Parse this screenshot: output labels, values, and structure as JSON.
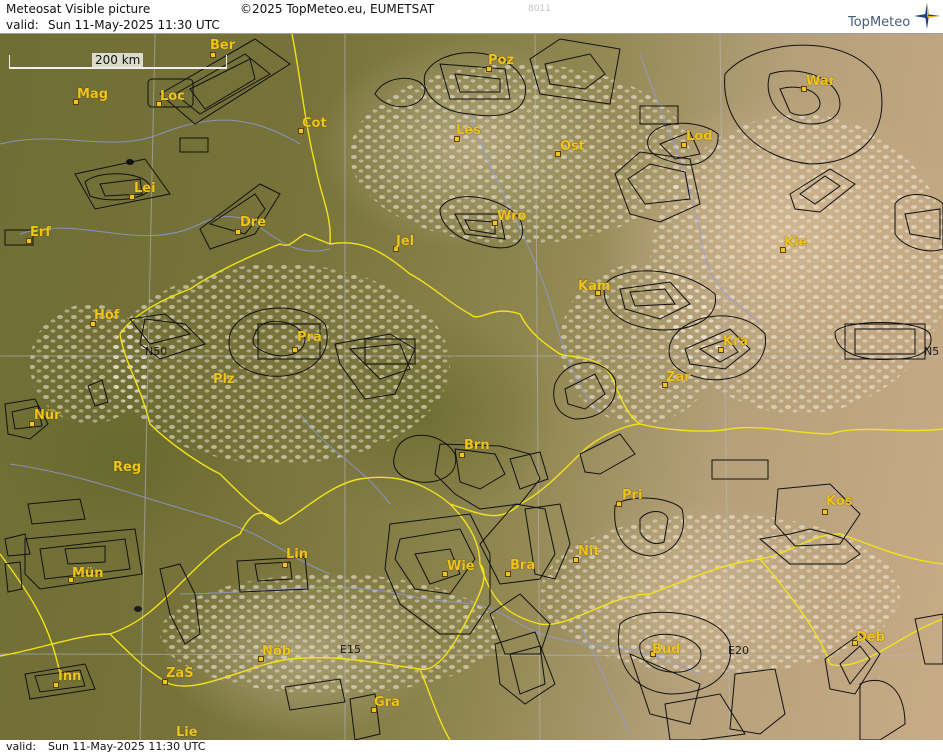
{
  "header": {
    "title": "Meteosat Visible picture",
    "copyright": "©2025 TopMeteo.eu, EUMETSAT",
    "code": "8011",
    "valid_label": "valid:",
    "valid_time": "Sun  11-May-2025  11:30 UTC",
    "brand": "TopMeteo"
  },
  "map": {
    "scale_label": "200 km",
    "grid_labels": [
      "N50",
      "N5",
      "E15",
      "E20"
    ],
    "colors": {
      "border": "#f2e21a",
      "rivers": "#8e9ee8",
      "grid": "#b8b8c0",
      "areas": "#111111",
      "city": "#f0c419"
    },
    "cities": [
      "Ber",
      "Poz",
      "War",
      "Mag",
      "Loc",
      "Cot",
      "Les",
      "Ost",
      "Lod",
      "Lei",
      "Dre",
      "Wro",
      "Erf",
      "Jel",
      "Kie",
      "Kam",
      "Hof",
      "Pra",
      "Kra",
      "Plz",
      "Zar",
      "Nür",
      "Brn",
      "Reg",
      "Pri",
      "Kos",
      "Lin",
      "Nit",
      "Wie",
      "Bra",
      "Mün",
      "Nöb",
      "Bud",
      "Deb",
      "Inn",
      "ZaS",
      "Gra",
      "Lie"
    ]
  },
  "footer": {
    "valid_label": "valid:",
    "valid_time": "Sun  11-May-2025  11:30 UTC"
  }
}
